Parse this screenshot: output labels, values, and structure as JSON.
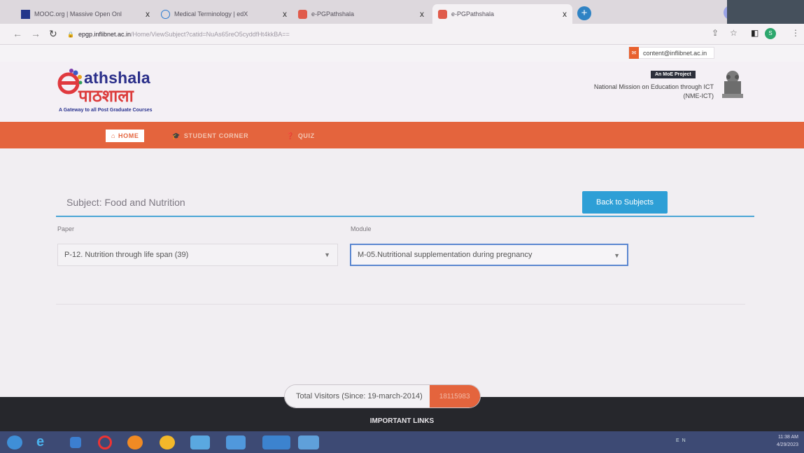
{
  "browser": {
    "tabs": [
      {
        "title": "MOOC.org | Massive Open Onl",
        "close": "x"
      },
      {
        "title": "Medical Terminology | edX",
        "close": "x"
      },
      {
        "title": "e-PGPathshala",
        "close": "x"
      },
      {
        "title": "e-PGPathshala",
        "close": "x"
      }
    ],
    "new_tab": "+",
    "url_host": "epgp.inflibnet.ac.in",
    "url_path": "/Home/ViewSubject?catid=NuAs65reO5cyddfHt4kkBA==",
    "profile_initial": "S"
  },
  "site": {
    "contact_email": "content@inflibnet.ac.in",
    "logo_en": "athshala",
    "logo_hi": "पाठशाला",
    "logo_tagline": "A Gateway to all Post Graduate Courses",
    "moe_badge": "An MoE Project",
    "nme_line1": "National Mission on Education through ICT",
    "nme_line2": "(NME-ICT)",
    "nav": {
      "home": "HOME",
      "student_corner": "STUDENT CORNER",
      "quiz": "QUIZ"
    }
  },
  "content": {
    "subject_label": "Subject: Food and Nutrition",
    "back_button": "Back to Subjects",
    "paper_label": "Paper",
    "paper_value": "P-12. Nutrition through life span (39)",
    "module_label": "Module",
    "module_value": "M-05.Nutritional supplementation during pregnancy"
  },
  "footer": {
    "visitors_label": "Total Visitors (Since: 19-march-2014)",
    "visitors_count": "18115983",
    "important_links": "IMPORTANT LINKS"
  },
  "taskbar": {
    "time": "11:38 AM",
    "date": "4/29/2023",
    "lang": "EN"
  },
  "colors": {
    "accent_orange": "#e4643d",
    "accent_blue": "#2e9fd6",
    "footer_dark": "#26272c"
  }
}
